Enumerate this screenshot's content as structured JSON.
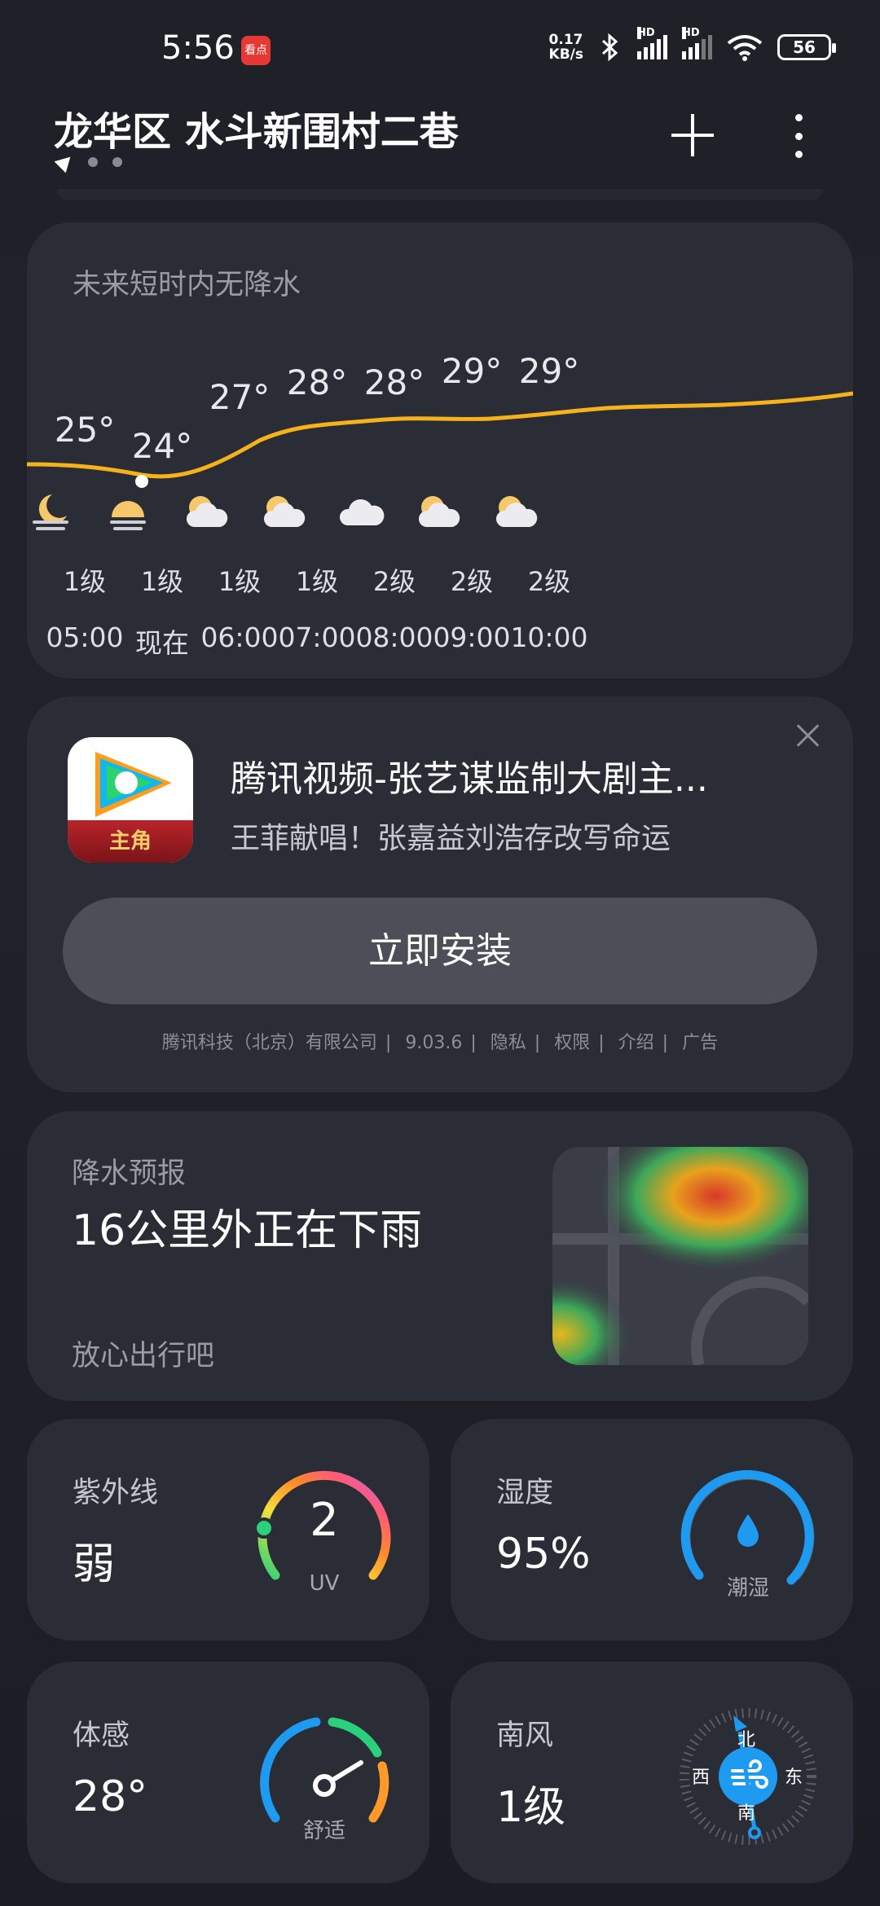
{
  "status_bar": {
    "time": "5:56",
    "app_icon_label": "看点",
    "net_speed_top": "0.17",
    "net_speed_bottom": "KB/s",
    "hd_label": "HD",
    "battery": "56"
  },
  "header": {
    "location": "龙华区 水斗新围村二巷"
  },
  "hourly": {
    "title": "未来短时内无降水",
    "items": [
      {
        "temp": "25°",
        "weather": "clear-night-icon",
        "wind": "1级",
        "time": "05:00"
      },
      {
        "temp": "24°",
        "weather": "sunrise-icon",
        "wind": "1级",
        "time": "现在"
      },
      {
        "temp": "27°",
        "weather": "partly-cloudy-icon",
        "wind": "1级",
        "time": "06:00"
      },
      {
        "temp": "28°",
        "weather": "partly-cloudy-icon",
        "wind": "1级",
        "time": "07:00"
      },
      {
        "temp": "28°",
        "weather": "cloudy-icon",
        "wind": "2级",
        "time": "08:00"
      },
      {
        "temp": "29°",
        "weather": "partly-cloudy-icon",
        "wind": "2级",
        "time": "09:00"
      },
      {
        "temp": "29°",
        "weather": "partly-cloudy-icon",
        "wind": "2级",
        "time": "10:00"
      }
    ],
    "line_color": "#f5b21a"
  },
  "ad": {
    "app_banner": "主角",
    "title": "腾讯视频-张艺谋监制大剧主...",
    "subtitle": "王菲献唱！张嘉益刘浩存改写命运",
    "install_label": "立即安装",
    "meta": [
      "腾讯科技（北京）有限公司",
      "9.03.6",
      "隐私",
      "权限",
      "介绍",
      "广告"
    ]
  },
  "precip": {
    "title": "降水预报",
    "main": "16公里外正在下雨",
    "footer": "放心出行吧"
  },
  "uv": {
    "label": "紫外线",
    "value": "弱",
    "index": "2",
    "unit": "UV"
  },
  "humidity": {
    "label": "湿度",
    "value": "95%",
    "desc": "潮湿"
  },
  "feels": {
    "label": "体感",
    "value": "28°",
    "desc": "舒适"
  },
  "wind": {
    "label": "南风",
    "value": "1级",
    "north": "北",
    "south": "南",
    "east": "东",
    "west": "西"
  },
  "colors": {
    "accent_blue": "#1e9bf0",
    "line_yellow": "#f5b21a"
  }
}
